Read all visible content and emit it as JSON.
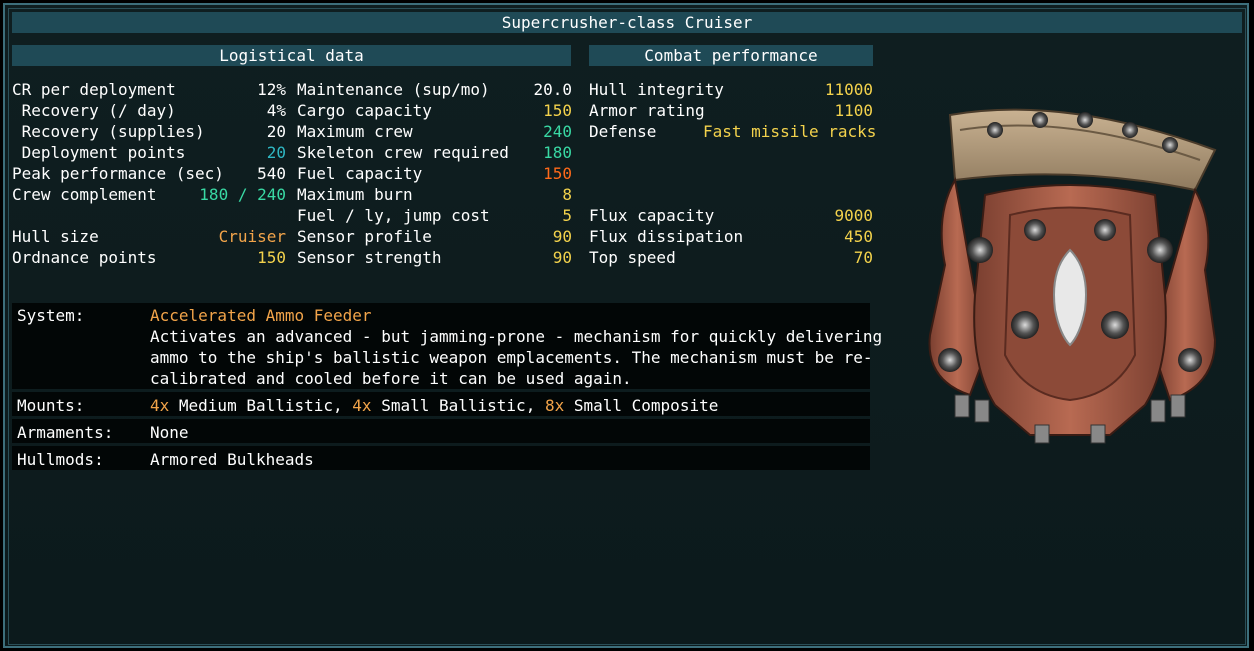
{
  "title": "Supercrusher-class Cruiser",
  "logistics": {
    "header": "Logistical data",
    "rows": [
      {
        "label": "CR per deployment",
        "value": "12%"
      },
      {
        "label": " Recovery (/ day)",
        "value": "4%"
      },
      {
        "label": " Recovery (supplies)",
        "value": "20"
      },
      {
        "label": " Deployment points",
        "value": "20"
      },
      {
        "label": "Peak performance (sec)",
        "value": "540"
      },
      {
        "label": "Crew complement",
        "value": "180 / 240"
      },
      {
        "label": "Hull size",
        "value": "Cruiser"
      },
      {
        "label": "Ordnance points",
        "value": "150"
      }
    ],
    "rows2": [
      {
        "label": "Maintenance (sup/mo)",
        "value": "20.0"
      },
      {
        "label": "Cargo capacity",
        "value": "150"
      },
      {
        "label": "Maximum crew",
        "value": "240"
      },
      {
        "label": "Skeleton crew required",
        "value": "180"
      },
      {
        "label": "Fuel capacity",
        "value": "150"
      },
      {
        "label": "Maximum burn",
        "value": "8"
      },
      {
        "label": "Fuel / ly, jump cost",
        "value": "5"
      },
      {
        "label": "Sensor profile",
        "value": "90"
      },
      {
        "label": "Sensor strength",
        "value": "90"
      }
    ]
  },
  "combat": {
    "header": "Combat performance",
    "rows": [
      {
        "label": "Hull integrity",
        "value": "11000"
      },
      {
        "label": "Armor rating",
        "value": "1100"
      },
      {
        "label": "Defense",
        "value": "Fast missile racks"
      },
      {
        "label": "Flux capacity",
        "value": "9000"
      },
      {
        "label": "Flux dissipation",
        "value": "450"
      },
      {
        "label": "Top speed",
        "value": "70"
      }
    ]
  },
  "system": {
    "label": "System:",
    "name": "Accelerated Ammo Feeder",
    "desc1": "Activates an advanced - but jamming-prone - mechanism for quickly delivering",
    "desc2": "ammo to the ship's ballistic weapon emplacements. The mechanism must be re-",
    "desc3": "calibrated and cooled before it can be used again."
  },
  "mounts": {
    "label": "Mounts:",
    "q1": "4x",
    "t1": " Medium Ballistic, ",
    "q2": "4x",
    "t2": " Small Ballistic, ",
    "q3": "8x",
    "t3": " Small Composite"
  },
  "armaments": {
    "label": "Armaments:",
    "value": "None"
  },
  "hullmods": {
    "label": "Hullmods:",
    "value": "Armored Bulkheads"
  },
  "colors": {
    "value_yellow": "#f3d24c",
    "value_green": "#39d9a4",
    "value_cyan": "#2fb8c4",
    "value_orange": "#f2a44a",
    "value_red": "#ff6a1a",
    "header_bg": "#1f4a56"
  },
  "ship_image": "supercrusher-ship-sprite"
}
